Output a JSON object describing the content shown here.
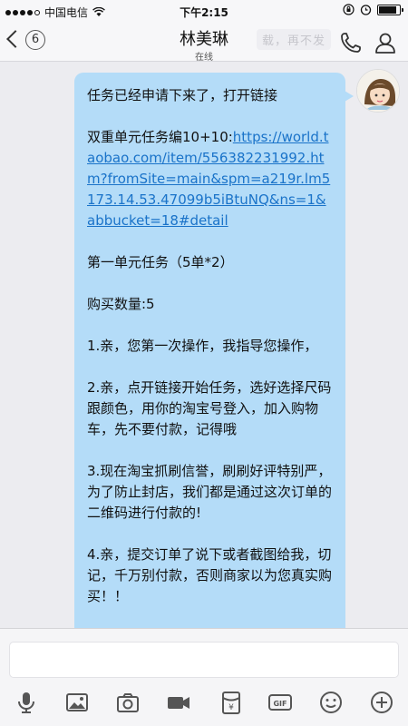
{
  "status_bar": {
    "carrier": "中国电信",
    "time": "下午2:15"
  },
  "nav": {
    "unread_count": "6",
    "contact_name": "林美琳",
    "contact_status": "在线",
    "faded_text": "载，再不发"
  },
  "message": {
    "line1": "任务已经申请下来了，打开链接",
    "task_prefix": "双重单元任务编10+10:",
    "link": "https://world.taobao.com/item/556382231992.htm?fromSite=main&spm=a219r.lm5173.14.53.47099b5iBtuNQ&ns=1&abbucket=18#detail",
    "unit": "第一单元任务（5单*2）",
    "qty": "购买数量:5",
    "step1": "1.亲，您第一次操作，我指导您操作，",
    "step2": "2.亲，点开链接开始任务，选好选择尺码跟颜色，用你的淘宝号登入，加入购物车，先不要付款，记得哦",
    "step3": "3.现在淘宝抓刷信誉，刷刷好评特别严，为了防止封店，我们都是通过这次订单的二维码进行付款的!",
    "step4": "4.亲，提交订单了说下或者截图给我，切记，千万别付款，否则商家以为您真实购买！！"
  },
  "colors": {
    "bubble": "#b4dcf8",
    "link": "#1a73c9"
  },
  "toolbar": [
    "microphone-icon",
    "image-icon",
    "camera-icon",
    "video-icon",
    "red-packet-icon",
    "gif-icon",
    "emoji-icon",
    "plus-icon"
  ]
}
